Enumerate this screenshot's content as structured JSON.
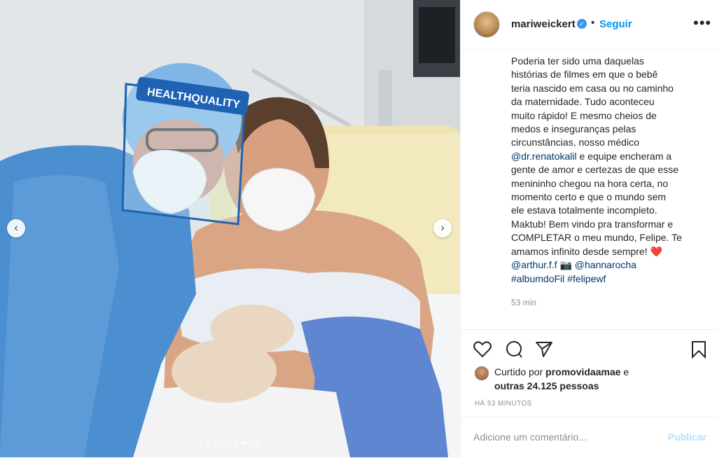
{
  "post": {
    "username": "mariweickert",
    "separator": "•",
    "follow_label": "Seguir",
    "more_label": "•••",
    "caption_lines": [
      "Poderia ter sido uma daquelas",
      "histórias de filmes em que o bebê",
      "teria nascido em casa ou no caminho",
      "da maternidade. Tudo aconteceu",
      "muito rápido! E mesmo cheios de",
      "medos e inseguranças pelas",
      "circunstâncias, nosso médico",
      "@dr.renatokalil e equipe encheram a",
      "gente de amor e certezas de que esse",
      "menininho chegou na hora certa, no",
      "momento certo e que o mundo sem",
      "ele estava totalmente incompleto.",
      "Maktub! Bem vindo pra transformar e",
      "COMPLETAR o meu mundo, Felipe. Te",
      "amamos infinito desde sempre! ❤️",
      "@arthur.f.f 📷 @hannarocha",
      "#albumdoFil #felipewf"
    ],
    "caption_time": "53 min",
    "likes": {
      "prefix": "Curtido por ",
      "user": "promovidaamae",
      "suffix": " e",
      "line2": "outras 24.125 pessoas"
    },
    "post_time": "HÁ 53 MINUTOS",
    "comment_placeholder": "Adicione um comentário...",
    "publish_label": "Publicar"
  },
  "media": {
    "prev_icon": "chevron-left-icon",
    "next_icon": "chevron-right-icon",
    "carousel_count": 9,
    "carousel_active_index": 6,
    "shield_text": "HEALTHQUALITY"
  },
  "colors": {
    "follow_blue": "#0095f6",
    "link_blue": "#00376b",
    "muted": "#8e8e8e",
    "verified_blue": "#3897f0"
  }
}
